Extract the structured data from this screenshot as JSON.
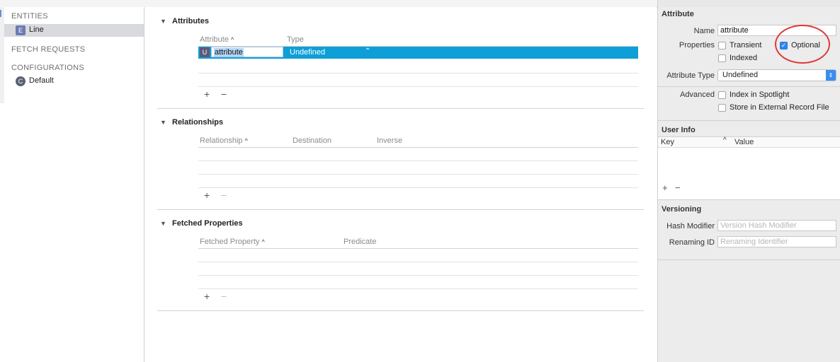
{
  "sidebar": {
    "entities_header": "ENTITIES",
    "entities": [
      {
        "badge": "E",
        "label": "Line"
      }
    ],
    "fetch_requests_header": "FETCH REQUESTS",
    "configurations_header": "CONFIGURATIONS",
    "configurations": [
      {
        "badge": "C",
        "label": "Default"
      }
    ]
  },
  "editor": {
    "attributes": {
      "title": "Attributes",
      "col_attribute": "Attribute",
      "col_type": "Type",
      "rows": [
        {
          "badge": "U",
          "name": "attribute",
          "type": "Undefined"
        }
      ],
      "add": "+",
      "remove": "−"
    },
    "relationships": {
      "title": "Relationships",
      "col_relationship": "Relationship",
      "col_destination": "Destination",
      "col_inverse": "Inverse",
      "add": "+",
      "remove": "−"
    },
    "fetched": {
      "title": "Fetched Properties",
      "col_fetched": "Fetched Property",
      "col_predicate": "Predicate",
      "add": "+",
      "remove": "−"
    },
    "sort_glyph": "^",
    "disclosure_glyph": "▼"
  },
  "inspector": {
    "attribute_header": "Attribute",
    "name_label": "Name",
    "name_value": "attribute",
    "properties_label": "Properties",
    "transient_label": "Transient",
    "transient_checked": false,
    "optional_label": "Optional",
    "optional_checked": true,
    "indexed_label": "Indexed",
    "indexed_checked": false,
    "attribute_type_label": "Attribute Type",
    "attribute_type_value": "Undefined",
    "advanced_label": "Advanced",
    "index_spotlight_label": "Index in Spotlight",
    "store_external_label": "Store in External Record File",
    "user_info_header": "User Info",
    "col_key": "Key",
    "col_value": "Value",
    "versioning_header": "Versioning",
    "hash_modifier_label": "Hash Modifier",
    "hash_modifier_placeholder": "Version Hash Modifier",
    "renaming_id_label": "Renaming ID",
    "renaming_id_placeholder": "Renaming Identifier",
    "add": "+",
    "remove": "−"
  },
  "colors": {
    "selection": "#0e9fd8",
    "checkbox_checked": "#2f86f5",
    "annotation_circle": "#e0393b"
  }
}
